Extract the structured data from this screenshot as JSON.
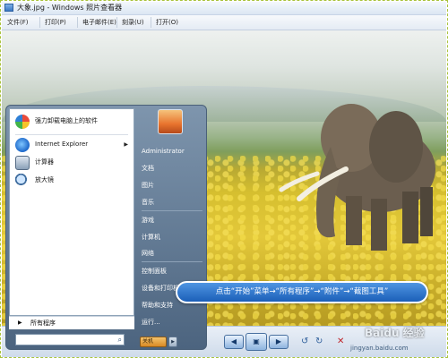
{
  "window": {
    "title": "大象.jpg - Windows 照片查看器"
  },
  "menubar": {
    "items": [
      {
        "label": "文件(F)"
      },
      {
        "label": "打印(P)"
      },
      {
        "label": "电子邮件(E)"
      },
      {
        "label": "刻录(U)"
      },
      {
        "label": "打开(O)"
      }
    ]
  },
  "startmenu": {
    "pinned": [
      {
        "label": "强力卸载电脑上的软件",
        "icon": "colorful-orb-icon"
      },
      {
        "label": "Internet Explorer",
        "icon": "ie-icon",
        "arrow": "▶"
      },
      {
        "label": "计算器",
        "icon": "calculator-icon"
      },
      {
        "label": "放大镜",
        "icon": "magnifier-icon"
      }
    ],
    "all_programs": "所有程序",
    "all_programs_arrow": "▶",
    "search_placeholder": "",
    "right": {
      "user": "Administrator",
      "items": [
        {
          "label": "文档"
        },
        {
          "label": "图片"
        },
        {
          "label": "音乐"
        },
        {
          "label": "游戏"
        },
        {
          "label": "计算机"
        },
        {
          "label": "网络"
        },
        {
          "label": "控制面板"
        },
        {
          "label": "设备和打印机"
        },
        {
          "label": "帮助和支持"
        },
        {
          "label": "运行..."
        }
      ]
    },
    "shutdown_label": "关机",
    "shutdown_arrow": "▶"
  },
  "callout": {
    "text": "点击“开始”菜单→“所有程序”→“附件”→“截图工具”"
  },
  "toolbar": {
    "prev": "◀",
    "play": "▣",
    "next": "▶",
    "rotate_left": "↺",
    "rotate_right": "↻",
    "delete": "✕"
  },
  "watermark": {
    "brand": "Baidu 经验",
    "url": "jingyan.baidu.com"
  },
  "colors": {
    "accent": "#1b5fb8",
    "startmenu": "#5a718a"
  }
}
